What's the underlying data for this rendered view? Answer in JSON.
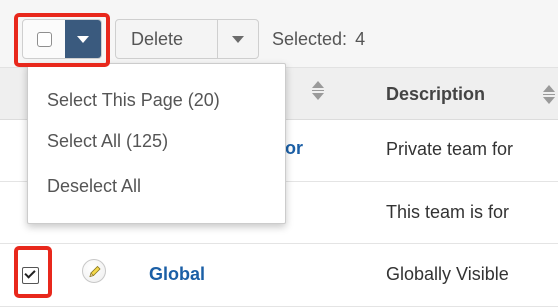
{
  "toolbar": {
    "delete_label": "Delete",
    "selected_label": "Selected:",
    "selected_count": "4"
  },
  "menu": {
    "items": [
      {
        "label": "Select This Page (20)"
      },
      {
        "label": "Select All (125)"
      },
      {
        "label": "Deselect All"
      }
    ]
  },
  "table": {
    "columns": [
      {
        "label": "Description"
      }
    ],
    "rows": [
      {
        "name": "…or",
        "description": "Private team for",
        "checked": false
      },
      {
        "name": "",
        "description": "This team is for",
        "checked": false
      },
      {
        "name": "Global",
        "description": "Globally Visible",
        "checked": true
      }
    ]
  },
  "colors": {
    "highlight": "#e8281c",
    "dropdown_button": "#3a5a7e",
    "link": "#1b5fa6"
  },
  "icons": [
    "checkbox-icon",
    "chevron-down-icon",
    "sort-icon",
    "pencil-icon",
    "checkmark-icon"
  ]
}
